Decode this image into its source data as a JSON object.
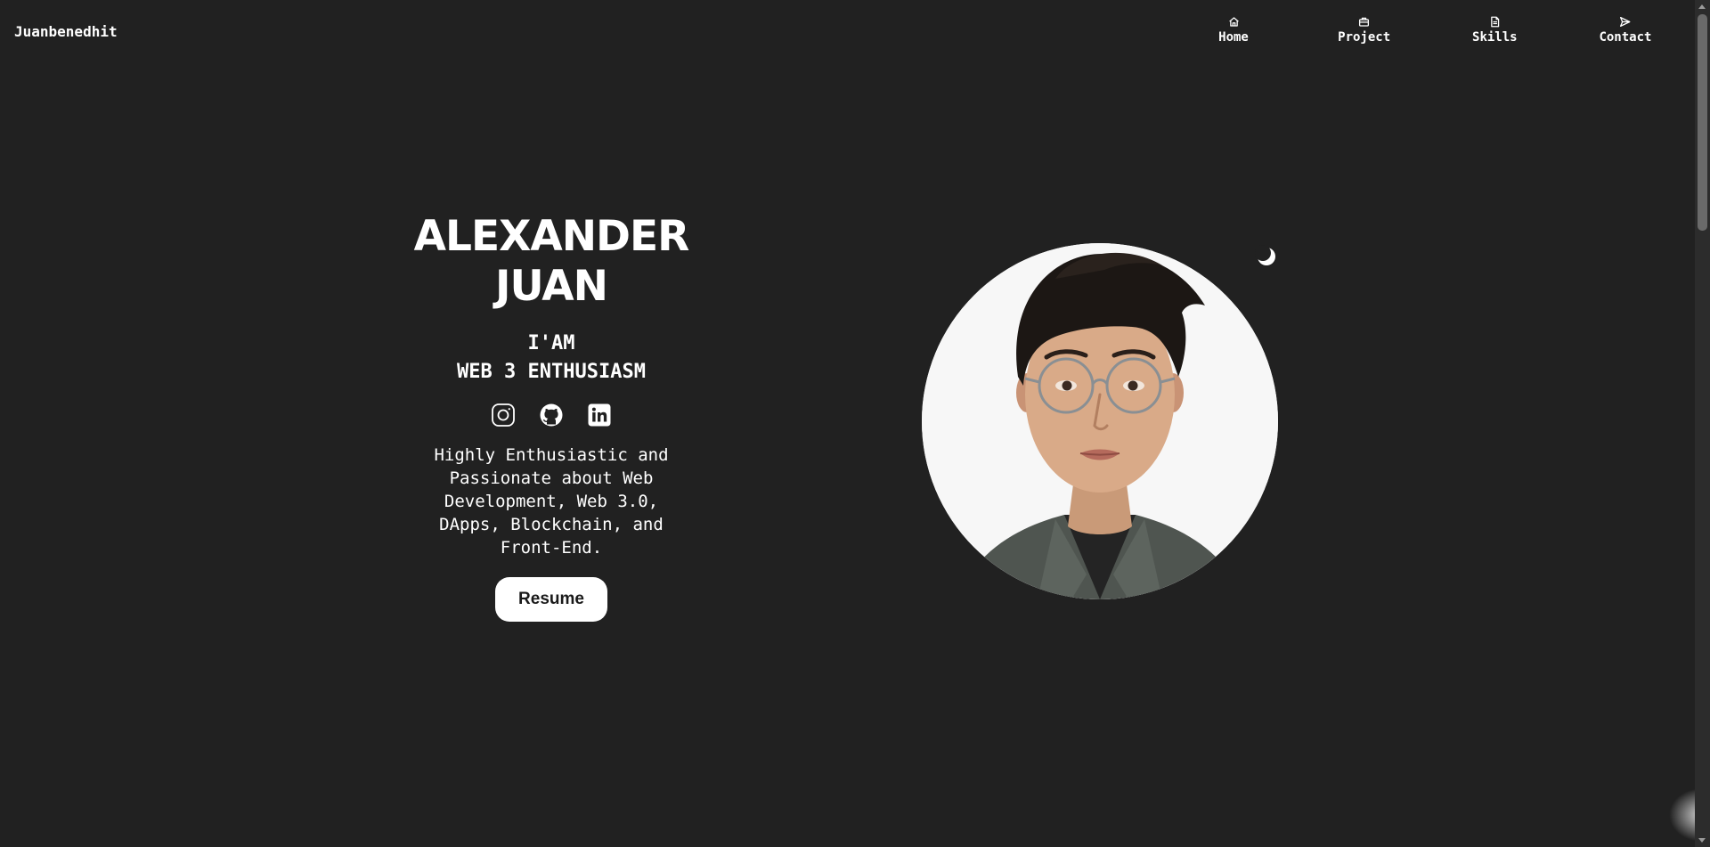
{
  "brand": "Juanbenedhit",
  "nav": {
    "items": [
      {
        "label": "Home",
        "icon": "home-icon"
      },
      {
        "label": "Project",
        "icon": "briefcase-icon"
      },
      {
        "label": "Skills",
        "icon": "document-icon"
      },
      {
        "label": "Contact",
        "icon": "send-icon"
      }
    ]
  },
  "hero": {
    "name_line1": "ALEXANDER",
    "name_line2": "JUAN",
    "role_line1": "I'AM",
    "role_line2": "WEB 3 ENTHUSIASM",
    "description": "Highly Enthusiastic and Passionate about Web Development, Web 3.0, DApps, Blockchain, and Front-End.",
    "resume_label": "Resume"
  },
  "socials": [
    {
      "name": "Instagram",
      "icon": "instagram-icon"
    },
    {
      "name": "GitHub",
      "icon": "github-icon"
    },
    {
      "name": "LinkedIn",
      "icon": "linkedin-icon"
    }
  ],
  "theme_toggle": {
    "icon": "moon-icon"
  },
  "colors": {
    "background": "#212121",
    "text": "#ffffff",
    "button_bg": "#ffffff",
    "button_text": "#1a1a1a"
  }
}
